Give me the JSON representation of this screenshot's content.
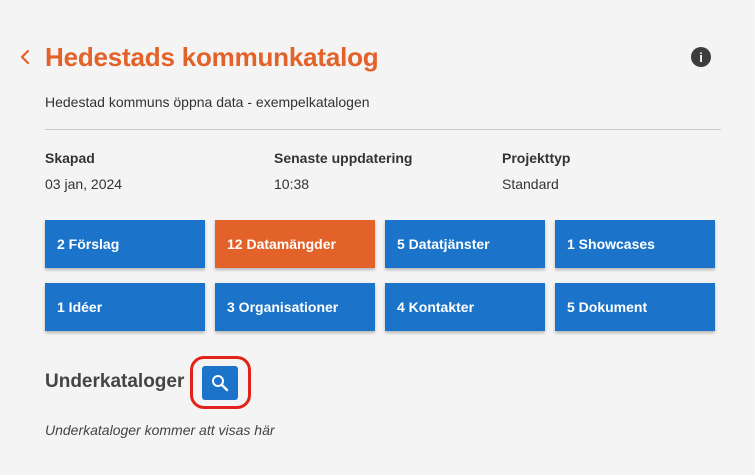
{
  "header": {
    "back_icon": "chevron-left-icon",
    "title": "Hedestads kommunkatalog",
    "info_icon": "info-icon",
    "info_glyph": "i",
    "subtitle": "Hedestad kommuns öppna data - exempelkatalogen"
  },
  "meta": [
    {
      "label": "Skapad",
      "value": "03 jan, 2024"
    },
    {
      "label": "Senaste uppdatering",
      "value": "10:38"
    },
    {
      "label": "Projekttyp",
      "value": "Standard"
    }
  ],
  "buttons": [
    {
      "label": "2 Förslag",
      "active": false
    },
    {
      "label": "12 Datamängder",
      "active": true
    },
    {
      "label": "5 Datatjänster",
      "active": false
    },
    {
      "label": "1 Showcases",
      "active": false
    },
    {
      "label": "1 Idéer",
      "active": false
    },
    {
      "label": "3 Organisationer",
      "active": false
    },
    {
      "label": "4 Kontakter",
      "active": false
    },
    {
      "label": "5 Dokument",
      "active": false
    }
  ],
  "subcatalogs": {
    "heading": "Underkataloger",
    "search_icon": "search-icon",
    "empty_text": "Underkataloger kommer att visas här"
  },
  "colors": {
    "accent": "#e3622a",
    "button_blue": "#1b74c9",
    "highlight": "#e2231a"
  }
}
